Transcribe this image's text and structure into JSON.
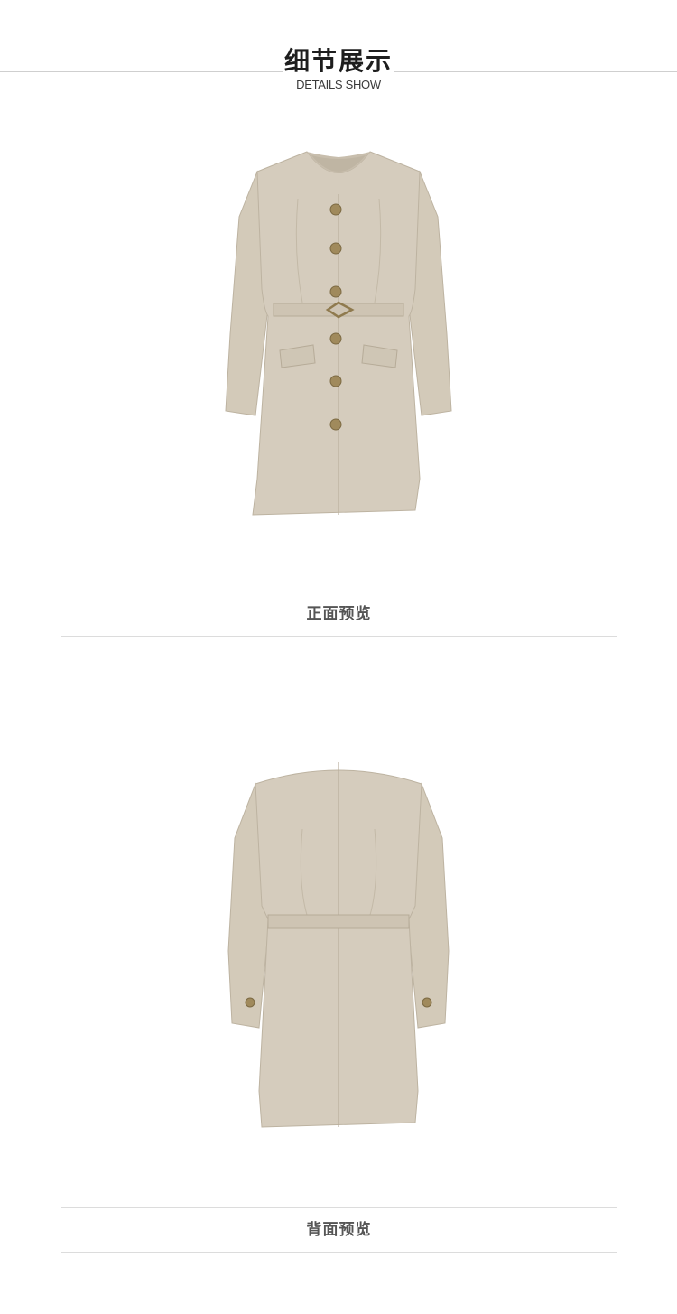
{
  "header": {
    "title": "细节展示",
    "subtitle": "DETAILS SHOW"
  },
  "sections": [
    {
      "caption": "正面预览",
      "image": "coat-front-view"
    },
    {
      "caption": "背面预览",
      "image": "coat-back-view"
    }
  ],
  "colors": {
    "fabric": "#d5ccbd",
    "fabric_shade": "#c6bcab",
    "lining": "#cfc5b4",
    "button": "#a08a5c",
    "rule": "#dcdcdc",
    "caption_text": "#555555"
  }
}
